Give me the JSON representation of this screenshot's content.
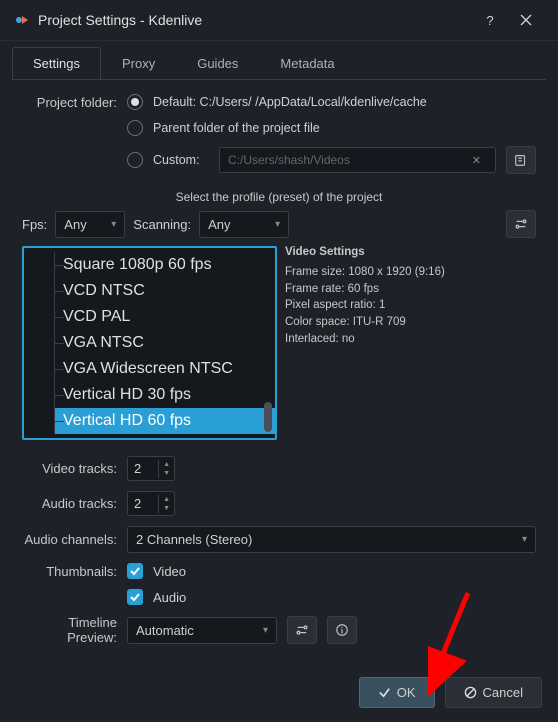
{
  "window": {
    "title": "Project Settings - Kdenlive"
  },
  "tabs": [
    "Settings",
    "Proxy",
    "Guides",
    "Metadata"
  ],
  "active_tab": 0,
  "project_folder": {
    "label": "Project folder:",
    "options": {
      "default": "Default: C:/Users/          /AppData/Local/kdenlive/cache",
      "parent": "Parent folder of the project file",
      "custom": "Custom:"
    },
    "custom_path": "C:/Users/shash/Videos"
  },
  "profile": {
    "title": "Select the profile (preset) of the project",
    "fps_label": "Fps:",
    "fps_value": "Any",
    "scan_label": "Scanning:",
    "scan_value": "Any",
    "items": [
      "Square 1080p 60 fps",
      "VCD NTSC",
      "VCD PAL",
      "VGA NTSC",
      "VGA Widescreen NTSC",
      "Vertical HD 30 fps",
      "Vertical HD 60 fps"
    ],
    "selected_index": 6
  },
  "video_settings": {
    "title": "Video Settings",
    "frame_size": "Frame size: 1080 x 1920 (9:16)",
    "frame_rate": "Frame rate: 60 fps",
    "par": "Pixel aspect ratio: 1",
    "color_space": "Color space: ITU-R 709",
    "interlaced": "Interlaced: no"
  },
  "tracks": {
    "video_label": "Video tracks:",
    "video_value": "2",
    "audio_label": "Audio tracks:",
    "audio_value": "2",
    "channels_label": "Audio channels:",
    "channels_value": "2 Channels (Stereo)"
  },
  "thumbnails": {
    "label": "Thumbnails:",
    "video": "Video",
    "audio": "Audio"
  },
  "preview": {
    "label": "Timeline Preview:",
    "value": "Automatic"
  },
  "buttons": {
    "ok": "OK",
    "cancel": "Cancel"
  }
}
